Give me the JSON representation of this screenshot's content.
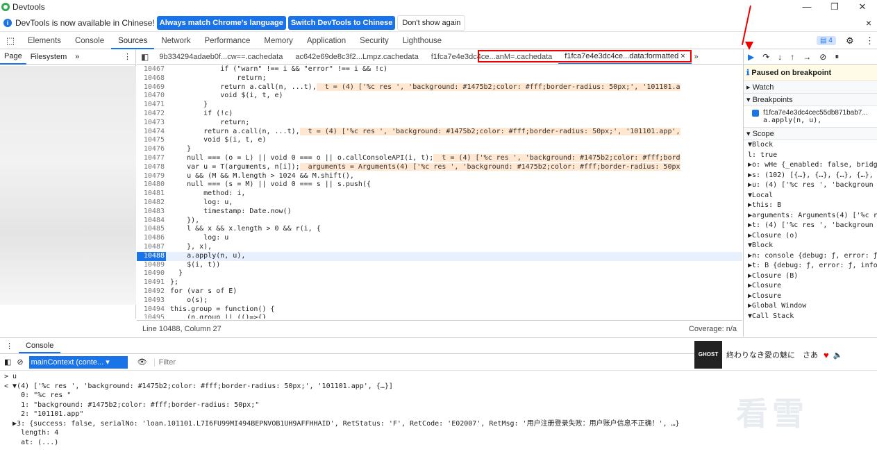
{
  "window": {
    "title": "Devtools",
    "minimize": "—",
    "restore": "❐",
    "close": "✕"
  },
  "infobar": {
    "message": "DevTools is now available in Chinese!",
    "btn_match": "Always match Chrome's language",
    "btn_switch": "Switch DevTools to Chinese",
    "btn_dismiss": "Don't show again",
    "close": "×"
  },
  "tabs": [
    "Elements",
    "Console",
    "Sources",
    "Network",
    "Performance",
    "Memory",
    "Application",
    "Security",
    "Lighthouse"
  ],
  "issues_count": "4",
  "navigator": {
    "page": "Page",
    "filesystem": "Filesystem",
    "more": "»"
  },
  "file_tabs": [
    "9b334294adaeb0f...cw==.cachedata",
    "ac642e69de8c3f2...Lmpz.cachedata",
    "f1fca7e4e3dc4ce...anM=.cachedata",
    "f1fca7e4e3dc4ce...data:formatted ×"
  ],
  "code_lines": [
    {
      "n": "10467",
      "t": "            if (\"warn\" !== i && \"error\" !== i && !c)"
    },
    {
      "n": "10468",
      "t": "                return;"
    },
    {
      "n": "10469",
      "t": "            return a.call(n, ...t),",
      "inl": "t = (4) ['%c res ', 'background: #1475b2;color: #fff;border-radius: 50px;', '101101.a"
    },
    {
      "n": "10470",
      "t": "            void $(i, t, e)"
    },
    {
      "n": "10471",
      "t": "        }"
    },
    {
      "n": "10472",
      "t": "        if (!c)"
    },
    {
      "n": "10473",
      "t": "            return;"
    },
    {
      "n": "10474",
      "t": "        return a.call(n, ...t),",
      "inl": "t = (4) ['%c res ', 'background: #1475b2;color: #fff;border-radius: 50px;', '101101.app',"
    },
    {
      "n": "10475",
      "t": "        void $(i, t, e)"
    },
    {
      "n": "10476",
      "t": "    }"
    },
    {
      "n": "10477",
      "t": "    null === (o = L) || void 0 === o || o.callConsoleAPI(i, t);",
      "inl": "t = (4) ['%c res ', 'background: #1475b2;color: #fff;bord"
    },
    {
      "n": "10478",
      "t": "    var u = T(arguments, n[i]);",
      "inl": "arguments = Arguments(4) ['%c res ', 'background: #1475b2;color: #fff;border-radius: 50px"
    },
    {
      "n": "10479",
      "t": "    u && (M && M.length > 1024 && M.shift(),"
    },
    {
      "n": "10480",
      "t": "    null === (s = M) || void 0 === s || s.push({"
    },
    {
      "n": "10481",
      "t": "        method: i,"
    },
    {
      "n": "10482",
      "t": "        log: u,"
    },
    {
      "n": "10483",
      "t": "        timestamp: Date.now()"
    },
    {
      "n": "10484",
      "t": "    }),"
    },
    {
      "n": "10485",
      "t": "    l && x && x.length > 0 && r(i, {"
    },
    {
      "n": "10486",
      "t": "        log: u"
    },
    {
      "n": "10487",
      "t": "    }, x),"
    },
    {
      "n": "10488",
      "t": "    a.apply(n, u),",
      "cur": true
    },
    {
      "n": "10489",
      "t": "    $(i, t))"
    },
    {
      "n": "10490",
      "t": "  }"
    },
    {
      "n": "10491",
      "t": "};"
    },
    {
      "n": "10492",
      "t": "for (var s of E)"
    },
    {
      "n": "10493",
      "t": "    o(s);"
    },
    {
      "n": "10494",
      "t": "this.group = function() {"
    },
    {
      "n": "10495",
      "t": "    (n.group || (()=>{}"
    }
  ],
  "status": {
    "position": "Line 10488, Column 27",
    "coverage": "Coverage: n/a"
  },
  "debugger": {
    "paused": "Paused on breakpoint",
    "watch": "Watch",
    "breakpoints": "Breakpoints",
    "bp_file": "f1fca7e4e3dc4cec55db871bab7...",
    "bp_code": "a.apply(n, u),",
    "scope": "Scope",
    "scope_lines": [
      "▼Block",
      "  l: true",
      "  ▶o: wHe {_enabled: false, bridg",
      "  ▶s: (102) [{…}, {…}, {…}, {…},",
      "  ▶u: (4) ['%c res ', 'backgroun",
      "▼Local",
      "  ▶this: B",
      "  ▶arguments: Arguments(4) ['%c r",
      "  ▶t: (4) ['%c res ', 'backgroun",
      "▶Closure (o)",
      "▼Block",
      "  ▶n: console {debug: ƒ, error: ƒ",
      "  ▶t: B {debug: ƒ, error: ƒ, info",
      "▶Closure (B)",
      "▶Closure",
      "▶Closure",
      "▶Global                 Window",
      "▼Call Stack"
    ]
  },
  "drawer": {
    "tab": "Console"
  },
  "console_toolbar": {
    "context": "mainContext (conte...",
    "filter_placeholder": "Filter"
  },
  "console_lines": [
    "> u",
    "< ▼(4) ['%c res ', 'background: #1475b2;color: #fff;border-radius: 50px;', '101101.app', {…}]",
    "    0: \"%c res \"",
    "    1: \"background: #1475b2;color: #fff;border-radius: 50px;\"",
    "    2: \"101101.app\"",
    "  ▶3: {success: false, serialNo: 'loan.101101.L7I6FU99MI494BEPNVOB1UH9AFFHHAID', RetStatus: 'F', RetCode: 'E02007', RetMsg: '用户注册登录失败：用户账户信息不正确！', …}",
    "    length: 4",
    "    at: (...)"
  ],
  "music": {
    "cover": "GHOST",
    "song": "終わりなき愛の魅に　さあ"
  },
  "watermark": "看雪"
}
